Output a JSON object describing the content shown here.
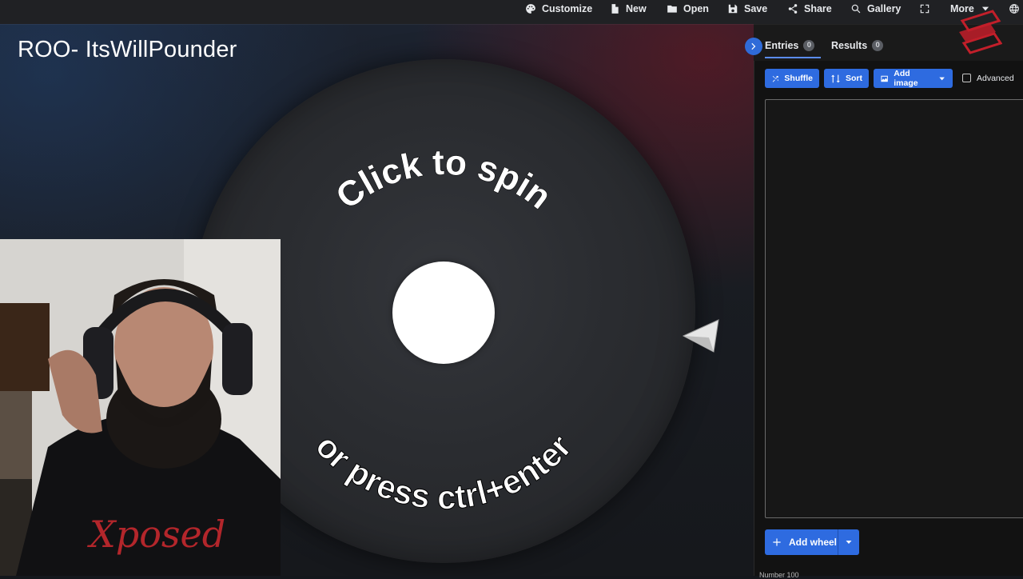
{
  "toolbar": {
    "customize": "Customize",
    "new": "New",
    "open": "Open",
    "save": "Save",
    "share": "Share",
    "gallery": "Gallery",
    "more": "More"
  },
  "overlay": {
    "title": "ROO- ItsWillPounder"
  },
  "wheel": {
    "text_top": "Click to spin",
    "text_bottom": "or press ctrl+enter"
  },
  "panel": {
    "tabs": [
      {
        "label": "Entries",
        "count": "0"
      },
      {
        "label": "Results",
        "count": "0"
      }
    ],
    "tools": {
      "shuffle": "Shuffle",
      "sort": "Sort",
      "add_image": "Add image",
      "advanced": "Advanced"
    },
    "add_wheel": "Add wheel",
    "footer": "Number 100"
  },
  "colors": {
    "accent": "#2e6be0",
    "toolbar_bg": "#202124",
    "panel_bg": "#121212"
  },
  "icons": {
    "customize": "palette-icon",
    "new": "file-icon",
    "open": "folder-icon",
    "save": "save-icon",
    "share": "share-icon",
    "gallery": "search-icon",
    "fullscreen": "fullscreen-icon",
    "more": "chevron-down-icon",
    "language": "globe-icon"
  }
}
